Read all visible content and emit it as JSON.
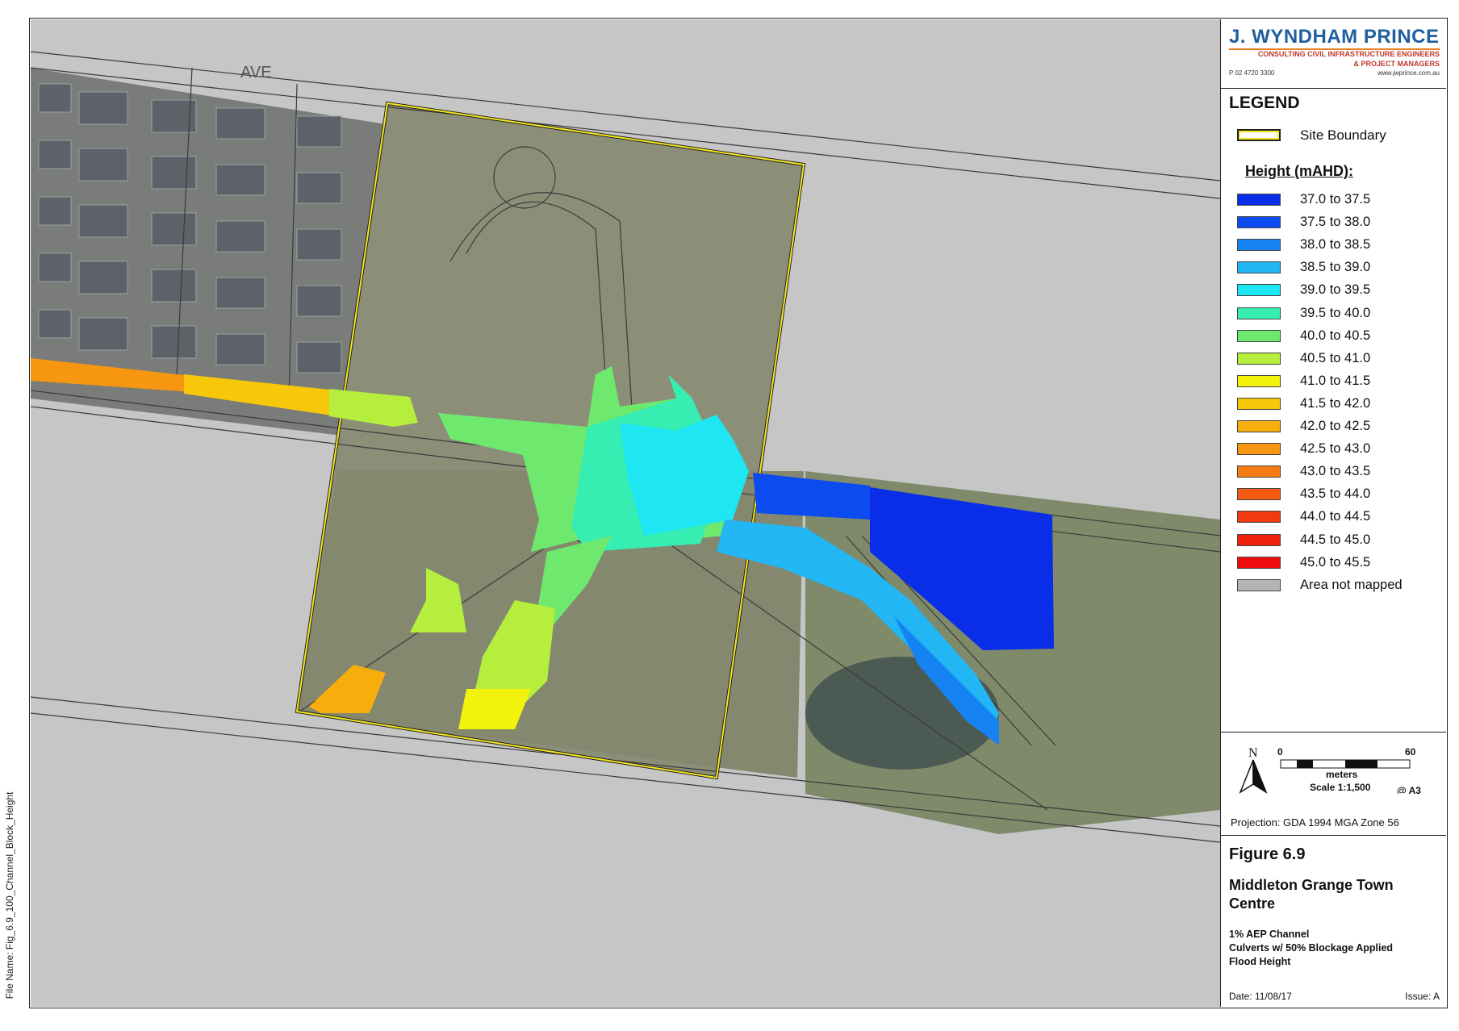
{
  "file_name": "File Name: Fig_6.9_100_Channel_Block_Height",
  "logo": {
    "company": "J. WYNDHAM PRINCE",
    "tagline_1": "CONSULTING CIVIL INFRASTRUCTURE ENGINEERS",
    "tagline_2": "& PROJECT MANAGERS",
    "phone": "P 02 4720 3300",
    "website": "www.jwprince.com.au"
  },
  "map": {
    "street_label": "AVE",
    "site_boundary_color": "#f4e81c"
  },
  "legend": {
    "title": "LEGEND",
    "site_boundary_label": "Site Boundary",
    "height_title": "Height (mAHD):",
    "classes": [
      {
        "label": "37.0 to 37.5",
        "color": "#0a2ee8"
      },
      {
        "label": "37.5 to 38.0",
        "color": "#0b4bf0"
      },
      {
        "label": "38.0 to 38.5",
        "color": "#1683f2"
      },
      {
        "label": "38.5 to 39.0",
        "color": "#22b6f5"
      },
      {
        "label": "39.0 to 39.5",
        "color": "#1ee6f2"
      },
      {
        "label": "39.5 to 40.0",
        "color": "#36edb2"
      },
      {
        "label": "40.0 to 40.5",
        "color": "#6fe86e"
      },
      {
        "label": "40.5 to 41.0",
        "color": "#b5ee3c"
      },
      {
        "label": "41.0 to 41.5",
        "color": "#f2f20a"
      },
      {
        "label": "41.5 to 42.0",
        "color": "#f7c80a"
      },
      {
        "label": "42.0 to 42.5",
        "color": "#f7ad0c"
      },
      {
        "label": "42.5 to 43.0",
        "color": "#f79610"
      },
      {
        "label": "43.0 to 43.5",
        "color": "#f57c12"
      },
      {
        "label": "43.5 to 44.0",
        "color": "#f45a12"
      },
      {
        "label": "44.0 to 44.5",
        "color": "#f23a10"
      },
      {
        "label": "44.5 to 45.0",
        "color": "#f0200e"
      },
      {
        "label": "45.0 to 45.5",
        "color": "#ee0c0c"
      },
      {
        "label": "Area not mapped",
        "color": "#b4b4b4"
      }
    ]
  },
  "scale": {
    "north_label": "N",
    "tick_start": "0",
    "tick_end": "60",
    "units": "meters",
    "scale_text": "Scale 1:1,500",
    "paper": "@ A3",
    "projection": "Projection: GDA 1994 MGA Zone 56"
  },
  "figure": {
    "number": "Figure 6.9",
    "title": "Middleton Grange Town Centre",
    "description_lines": [
      "1% AEP Channel",
      "Culverts w/ 50% Blockage Applied",
      "Flood Height"
    ],
    "date": "Date: 11/08/17",
    "issue": "Issue: A"
  }
}
